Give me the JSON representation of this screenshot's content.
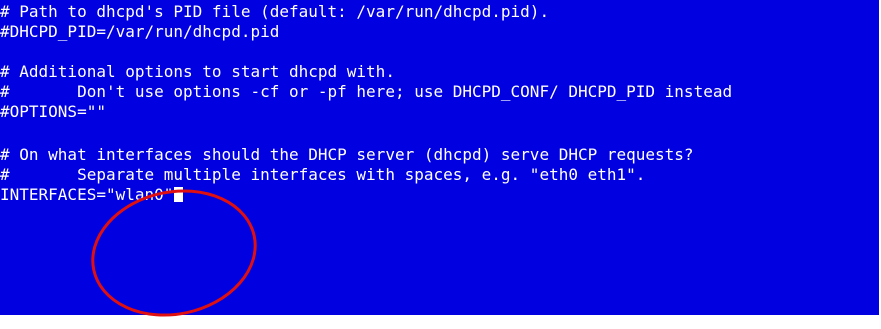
{
  "terminal": {
    "background_color": "#0000e0",
    "text_color": "#ffffff",
    "lines": [
      "# Path to dhcpd's PID file (default: /var/run/dhcpd.pid).",
      "#DHCPD_PID=/var/run/dhcpd.pid",
      "# Additional options to start dhcpd with.",
      "#       Don't use options -cf or -pf here; use DHCPD_CONF/ DHCPD_PID instead",
      "#OPTIONS=\"\"",
      "# On what interfaces should the DHCP server (dhcpd) serve DHCP requests?",
      "#       Separate multiple interfaces with spaces, e.g. \"eth0 eth1\".",
      "INTERFACES=\"wlan0\""
    ]
  },
  "annotation": {
    "shape": "ellipse",
    "color": "#e01010"
  }
}
